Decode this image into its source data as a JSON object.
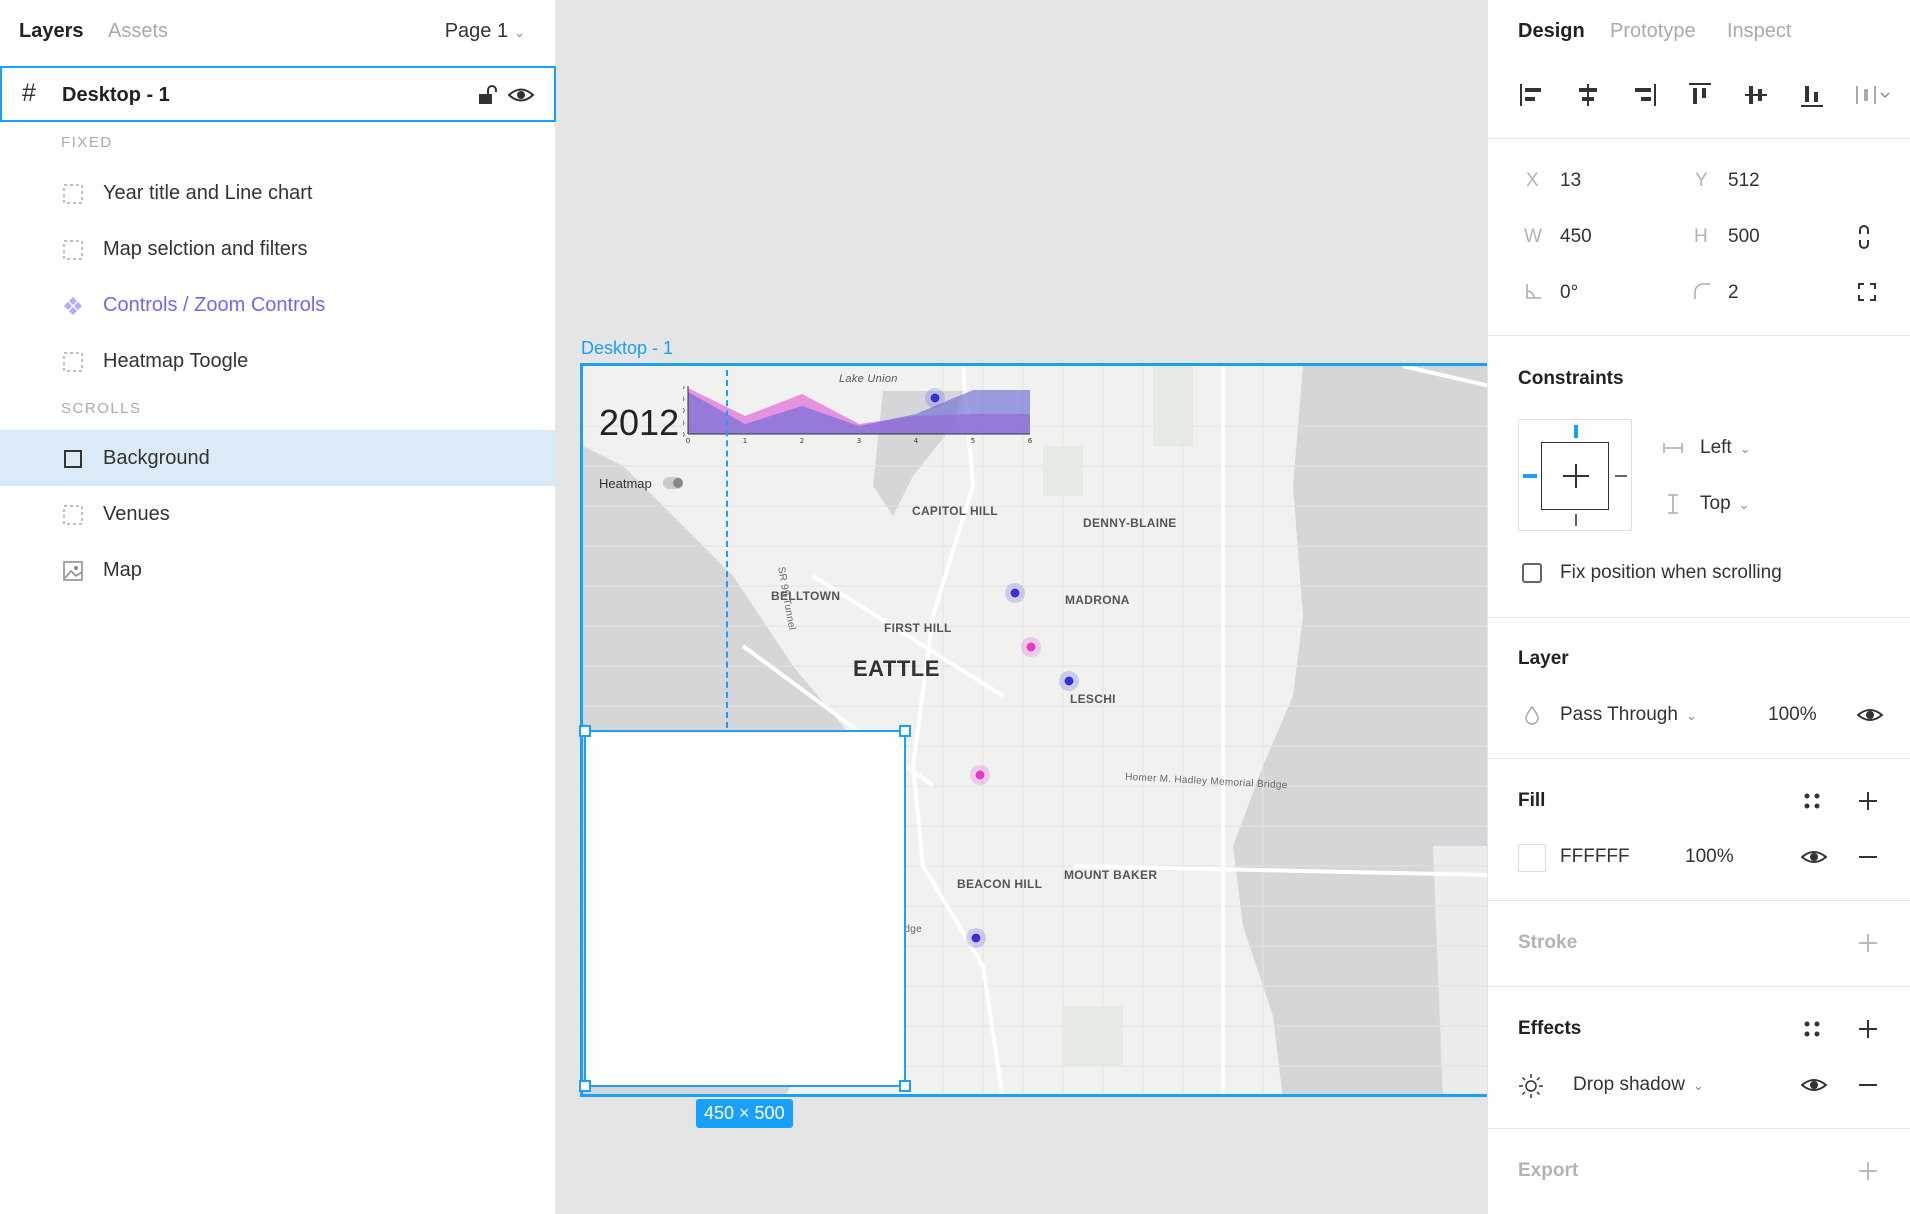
{
  "left_panel": {
    "tabs": {
      "layers": "Layers",
      "assets": "Assets"
    },
    "page_selector": "Page 1",
    "frame": {
      "name": "Desktop - 1"
    },
    "sections": {
      "fixed": "FIXED",
      "scrolls": "SCROLLS"
    },
    "fixed_layers": [
      {
        "name": "Year title and Line chart",
        "icon": "frame-dashed-icon"
      },
      {
        "name": "Map selction and filters",
        "icon": "frame-dashed-icon"
      },
      {
        "name": "Controls / Zoom Controls",
        "icon": "component-instance-icon"
      },
      {
        "name": "Heatmap Toogle",
        "icon": "frame-dashed-icon"
      }
    ],
    "scroll_layers": [
      {
        "name": "Background",
        "icon": "rectangle-icon",
        "selected": true
      },
      {
        "name": "Venues",
        "icon": "frame-dashed-icon"
      },
      {
        "name": "Map",
        "icon": "image-icon"
      }
    ]
  },
  "canvas": {
    "frame_label": "Desktop - 1",
    "year": "2012",
    "heatmap_label": "Heatmap",
    "mini_chart": {
      "y_ticks": [
        "20",
        "15",
        "10",
        "5",
        "0"
      ],
      "x_ticks": [
        "0",
        "1",
        "2",
        "3",
        "4",
        "5",
        "6"
      ],
      "series_colors": [
        "#e06ad8",
        "#6b6bd6"
      ]
    },
    "places": {
      "lake_union": "Lake Union",
      "capitol_hill": "CAPITOL HILL",
      "denny_blaine": "DENNY-BLAINE",
      "belltown": "BELLTOWN",
      "madrona": "MADRONA",
      "first_hill": "FIRST HILL",
      "seattle": "EATTLE",
      "leschi": "LESCHI",
      "beacon_hill": "BEACON HILL",
      "mount_baker": "MOUNT BAKER",
      "sr99": "SR 99 Tunnel",
      "bridge": "Homer M. Hadley Memorial Bridge",
      "seattle_bridge": "Seattle Bridge"
    },
    "size_badge": "450 × 500"
  },
  "right_panel": {
    "tabs": {
      "design": "Design",
      "prototype": "Prototype",
      "inspect": "Inspect"
    },
    "position": {
      "x_label": "X",
      "x": "13",
      "y_label": "Y",
      "y": "512",
      "w_label": "W",
      "w": "450",
      "h_label": "H",
      "h": "500",
      "rotation": "0°",
      "radius": "2"
    },
    "constraints": {
      "title": "Constraints",
      "horizontal": "Left",
      "vertical": "Top",
      "fix_scroll": "Fix position when scrolling"
    },
    "layer": {
      "title": "Layer",
      "blend": "Pass Through",
      "opacity": "100%"
    },
    "fill": {
      "title": "Fill",
      "hex": "FFFFFF",
      "opacity": "100%"
    },
    "stroke": {
      "title": "Stroke"
    },
    "effects": {
      "title": "Effects",
      "effect": "Drop shadow"
    },
    "export": {
      "title": "Export"
    },
    "colors": {
      "accent": "#18a0fb",
      "component": "#7b61ff"
    }
  }
}
